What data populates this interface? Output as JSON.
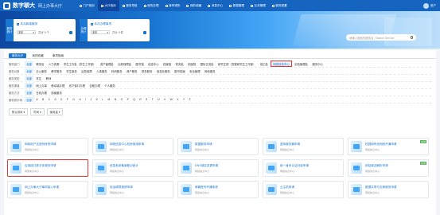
{
  "header": {
    "brand": "数字聊大",
    "brand_sub": "网上办事大厅",
    "nav": [
      {
        "label": "门户首页",
        "icon": "home-icon"
      },
      {
        "label": "大厅首页",
        "icon": "hall-icon"
      },
      {
        "label": "服务导航",
        "icon": "compass-icon"
      },
      {
        "label": "我的办理",
        "icon": "folder-icon"
      },
      {
        "label": "我申请的",
        "icon": "doc-icon"
      },
      {
        "label": "我的收藏",
        "icon": "star-icon"
      },
      {
        "label": "消息中心",
        "icon": "bell-icon"
      },
      {
        "label": "数据管理",
        "icon": "data-icon"
      },
      {
        "label": "业务管理",
        "icon": "gear-icon"
      },
      {
        "label": "服务配置",
        "icon": "config-icon"
      }
    ],
    "active_nav_index": 1,
    "user_name": "用户"
  },
  "banner": {
    "cards": [
      {
        "tag": "服务统计",
        "title": "本月新增服务",
        "select": "本年",
        "value": "共计 0 个"
      },
      {
        "tag": "办理统计",
        "title": "本月办理事项",
        "select": "本年",
        "value": "共计 0 件"
      }
    ],
    "search_placeholder": "请输入搜索的服务名 / Search Service"
  },
  "main": {
    "tabs": [
      "服务大厅",
      "我的收藏",
      "事项指南"
    ],
    "active_tab": 0,
    "filters": [
      {
        "label": "服务部门",
        "items": [
          "全部",
          "教务处",
          "人力资源",
          "学生工作处（学生工作部）",
          "资产管理处",
          "后勤保障处",
          "图书馆",
          "信息中心",
          "档案馆",
          "财务处",
          "校医院",
          "国际交流处",
          "研究生院（党委研究生工作部）",
          "保卫处",
          "网络信息中心",
          "实验管理处",
          "服务中心"
        ],
        "selected": 14
      },
      {
        "label": "服务对象",
        "items": [
          "全部",
          "办公服务",
          "教学服务",
          "学生事务",
          "后勤保障",
          "人事服务",
          "科研服务",
          "资产服务",
          "财务服务",
          "信息化服务",
          "图书档案",
          "安全管理",
          "其他服务"
        ],
        "selected": -1
      },
      {
        "label": "服务类型",
        "items": [
          "全部",
          "学生",
          "教师"
        ],
        "selected": -1
      },
      {
        "label": "服务渠道",
        "items": [
          "全部",
          "网上办事",
          "移动端办理",
          "线下窗口办理",
          "自助办理",
          "个人服务"
        ],
        "selected": -1
      },
      {
        "label": "服务方式",
        "items": [
          "全部",
          "在线办理",
          "指南服务"
        ],
        "selected": -1
      },
      {
        "label": "服务首字母",
        "items": [
          "全部",
          "A",
          "B",
          "C",
          "D",
          "E",
          "F",
          "G",
          "H",
          "I",
          "J",
          "K",
          "L",
          "M",
          "N",
          "O",
          "P",
          "Q",
          "R",
          "S",
          "T",
          "U",
          "V",
          "W",
          "X",
          "Y",
          "Z"
        ],
        "selected": -1
      }
    ],
    "sort": [
      "默认排序",
      "时间",
      "使用量"
    ],
    "cards": [
      {
        "title": "网络用户名密码修改申请",
        "sub": "网络信息中心",
        "tag": ""
      },
      {
        "title": "网络信息中心机房使用申请",
        "sub": "网络信息中心",
        "tag": ""
      },
      {
        "title": "数据服务申请",
        "sub": "网络信息中心",
        "tag": ""
      },
      {
        "title": "虚拟服务器申请",
        "sub": "网络信息中心",
        "tag": ""
      },
      {
        "title": "校园网有线网络开通申请",
        "sub": "网络信息中心",
        "tag": "在线"
      },
      {
        "title": "应用接口数字化服务申请",
        "sub": "网络信息中心",
        "tag": ""
      },
      {
        "title": "信息系统备案登记统计",
        "sub": "网络信息中心",
        "tag": ""
      },
      {
        "title": "DNS域名变更申请",
        "sub": "网络信息中心",
        "tag": ""
      },
      {
        "title": "统一身份认证对接申请",
        "sub": "网络信息中心",
        "tag": ""
      },
      {
        "title": "网站域名解析申请",
        "sub": "网络信息中心",
        "tag": "在线"
      },
      {
        "title": "网上办事大厅事项接入申请",
        "sub": "网络信息中心",
        "tag": ""
      },
      {
        "title": "电话故障报修申请",
        "sub": "网络信息中心",
        "tag": ""
      },
      {
        "title": "邮箱账号开通申请",
        "sub": "网络信息中心",
        "tag": ""
      },
      {
        "title": "云主机申请",
        "sub": "网络信息中心",
        "tag": ""
      },
      {
        "title": "数据共享与交换服务申请",
        "sub": "网络信息中心",
        "tag": ""
      }
    ]
  }
}
